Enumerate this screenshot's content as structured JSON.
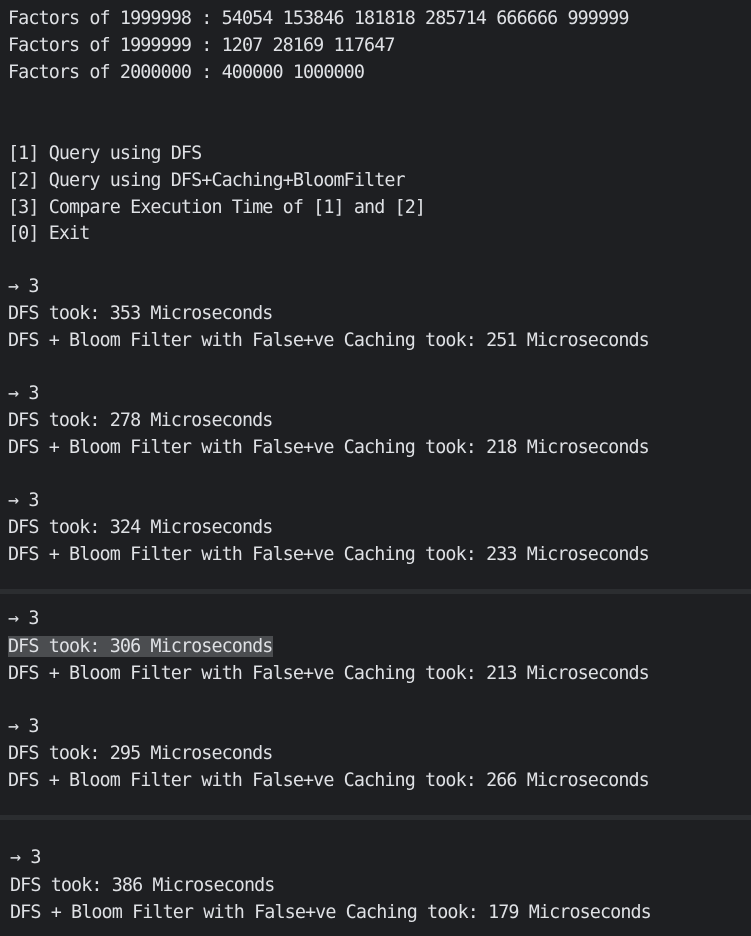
{
  "panel1": {
    "factors": [
      "Factors of 1999998 : 54054 153846 181818 285714 666666 999999",
      "Factors of 1999999 : 1207 28169 117647",
      "Factors of 2000000 : 400000 1000000"
    ],
    "menu": [
      "[1] Query using DFS",
      "[2] Query using DFS+Caching+BloomFilter",
      "[3] Compare Execution Time of [1] and [2]",
      "[0] Exit"
    ],
    "runs": [
      {
        "prompt": "→ 3",
        "dfs": "DFS took: 353 Microseconds",
        "bloom": "DFS + Bloom Filter with False+ve Caching took: 251 Microseconds"
      },
      {
        "prompt": "→ 3",
        "dfs": "DFS took: 278 Microseconds",
        "bloom": "DFS + Bloom Filter with False+ve Caching took: 218 Microseconds"
      },
      {
        "prompt": "→ 3",
        "dfs": "DFS took: 324 Microseconds",
        "bloom": "DFS + Bloom Filter with False+ve Caching took: 233 Microseconds"
      }
    ]
  },
  "panel2": {
    "runs": [
      {
        "prompt": "→ 3",
        "dfs": "DFS took: 306 Microseconds",
        "bloom": "DFS + Bloom Filter with False+ve Caching took: 213 Microseconds"
      },
      {
        "prompt": "→ 3",
        "dfs": "DFS took: 295 Microseconds",
        "bloom": "DFS + Bloom Filter with False+ve Caching took: 266 Microseconds"
      }
    ]
  },
  "panel3": {
    "runs": [
      {
        "prompt": "→ 3",
        "dfs": "DFS took: 386 Microseconds",
        "bloom": "DFS + Bloom Filter with False+ve Caching took: 179 Microseconds"
      }
    ]
  },
  "colors": {
    "background": "#1e1f22",
    "text": "#dfe1e5",
    "separator": "#2b2d30",
    "selection": "#4b4d50"
  }
}
